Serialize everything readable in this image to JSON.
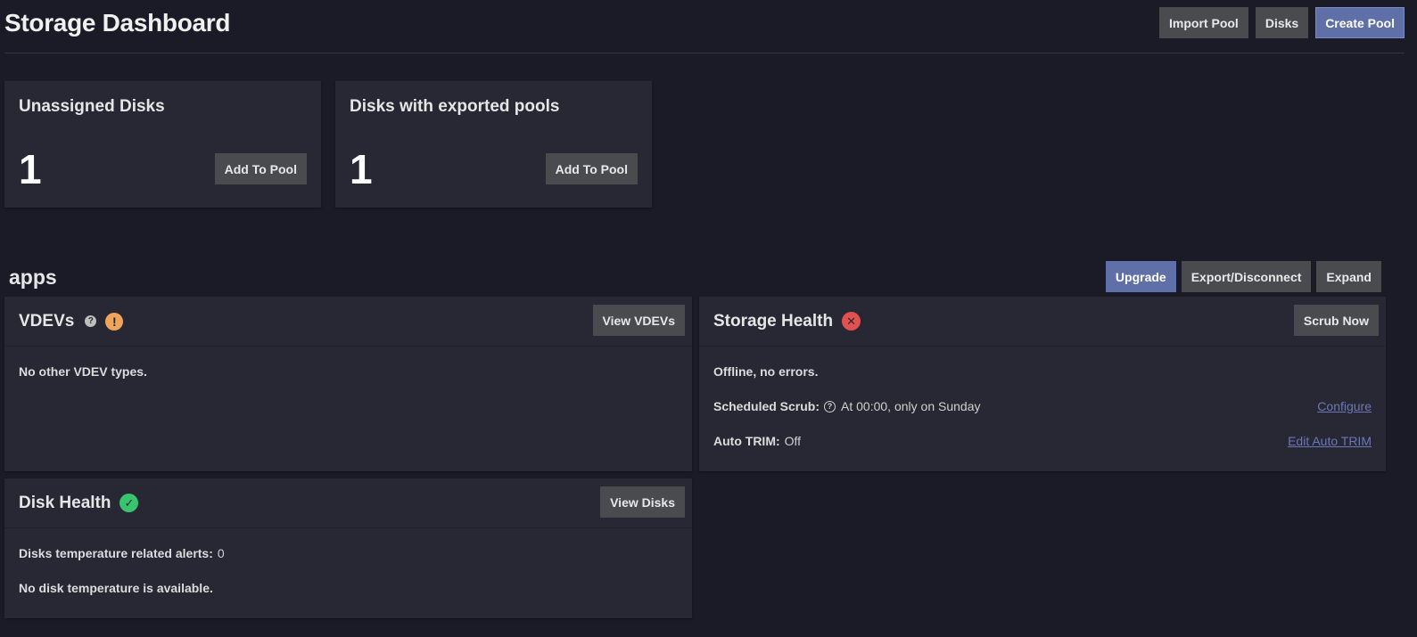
{
  "header": {
    "title": "Storage Dashboard",
    "import_pool_label": "Import Pool",
    "disks_label": "Disks",
    "create_pool_label": "Create Pool"
  },
  "unassigned": {
    "title": "Unassigned Disks",
    "count": "1",
    "button_label": "Add To Pool"
  },
  "exported": {
    "title": "Disks with exported pools",
    "count": "1",
    "button_label": "Add To Pool"
  },
  "pool": {
    "name": "apps",
    "upgrade_label": "Upgrade",
    "export_label": "Export/Disconnect",
    "expand_label": "Expand"
  },
  "vdevs": {
    "title": "VDEVs",
    "help_glyph": "?",
    "warn_glyph": "!",
    "button_label": "View VDEVs",
    "message": "No other VDEV types."
  },
  "storage_health": {
    "title": "Storage Health",
    "status_glyph": "✕",
    "button_label": "Scrub Now",
    "status_text": "Offline, no errors.",
    "scrub_label": "Scheduled Scrub:",
    "scrub_help_glyph": "?",
    "scrub_value": "At 00:00, only on Sunday",
    "scrub_link": "Configure",
    "trim_label": "Auto TRIM:",
    "trim_value": "Off",
    "trim_link": "Edit Auto TRIM"
  },
  "disk_health": {
    "title": "Disk Health",
    "status_glyph": "✓",
    "button_label": "View Disks",
    "temp_alerts_label": "Disks temperature related alerts:",
    "temp_alerts_value": "0",
    "temp_message": "No disk temperature is available."
  },
  "icons": {
    "help": "help-circle-icon",
    "warning": "alert-circle-icon",
    "error": "close-circle-icon",
    "success": "check-circle-icon"
  },
  "colors": {
    "background": "#1a1b26",
    "card": "#272833",
    "primary": "#5f6fa8",
    "button": "#4a4b4f",
    "warning": "#f0a35a",
    "error": "#e05252",
    "success": "#37c46f",
    "link": "#6b78b5"
  }
}
